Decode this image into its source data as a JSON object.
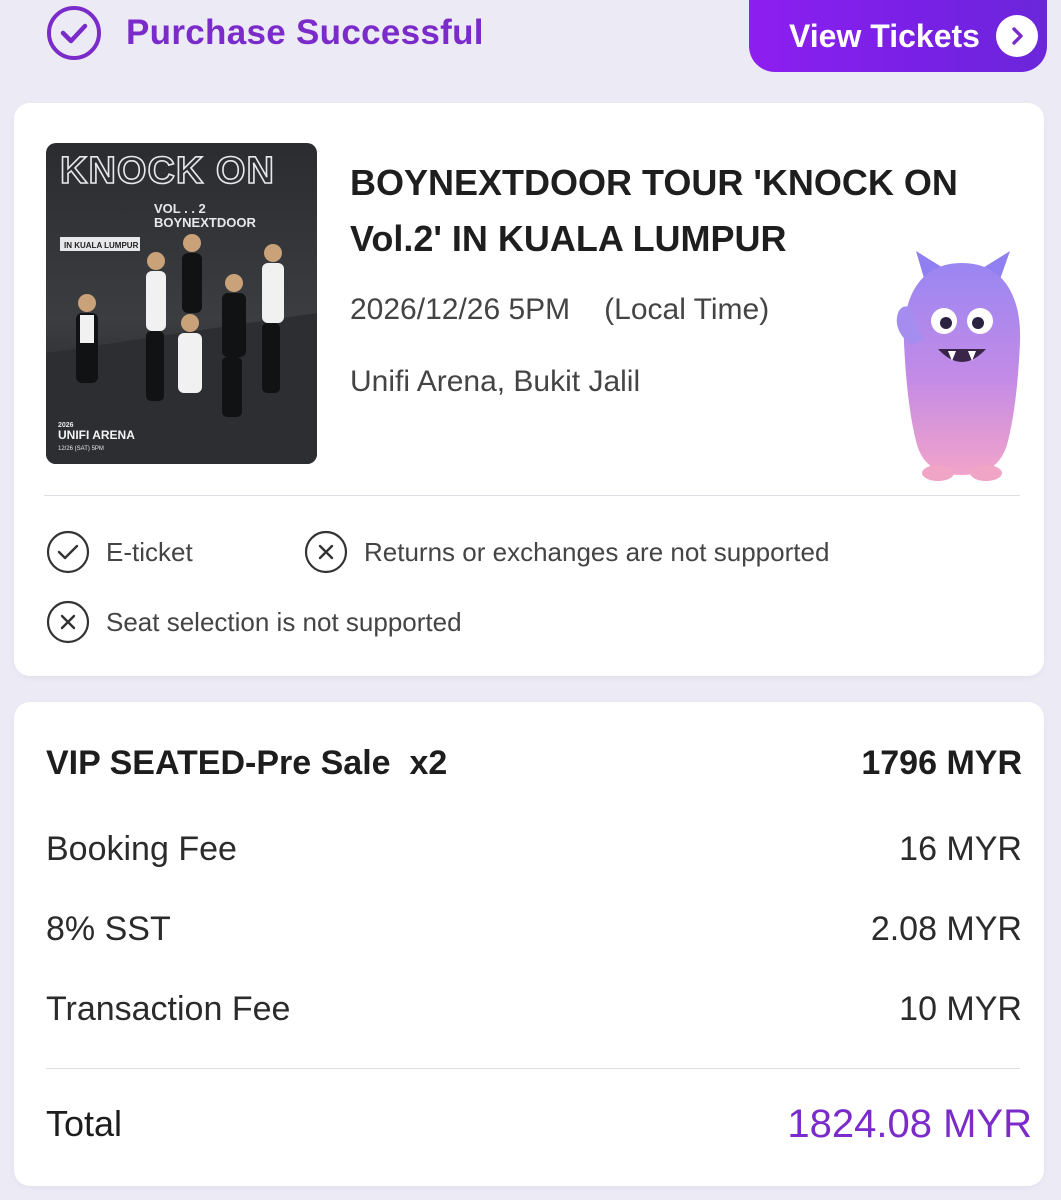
{
  "header": {
    "status_text": "Purchase Successful",
    "view_tickets_label": "View Tickets",
    "accent_color": "#7a2bc9"
  },
  "event": {
    "title_line1": "BOYNEXTDOOR TOUR 'KNOCK ON",
    "title_line2": "Vol.2' IN KUALA LUMPUR",
    "date": "2026/12/26 5PM",
    "time_note": "(Local Time)",
    "venue": "Unifi Arena, Bukit Jalil",
    "poster": {
      "title_big": "KNOCK ON",
      "vol": "VOL . . 2",
      "artist": "BOYNEXTDOOR",
      "city_tag": "IN KUALA LUMPUR",
      "year": "2026",
      "arena": "UNIFI ARENA",
      "date_small": "12/26 (SAT) 5PM"
    }
  },
  "features": [
    {
      "icon": "check-circle-icon",
      "label": "E-ticket"
    },
    {
      "icon": "x-circle-icon",
      "label": "Returns or exchanges are not supported"
    },
    {
      "icon": "x-circle-icon",
      "label": "Seat selection is not supported"
    }
  ],
  "pricing": {
    "items": [
      {
        "label": "VIP SEATED-Pre Sale  x2",
        "amount": "1796 MYR"
      },
      {
        "label": "Booking Fee",
        "amount": "16 MYR"
      },
      {
        "label": "8% SST",
        "amount": "2.08 MYR"
      },
      {
        "label": "Transaction Fee",
        "amount": "10 MYR"
      }
    ],
    "total_label": "Total",
    "total_amount": "1824.08 MYR"
  }
}
